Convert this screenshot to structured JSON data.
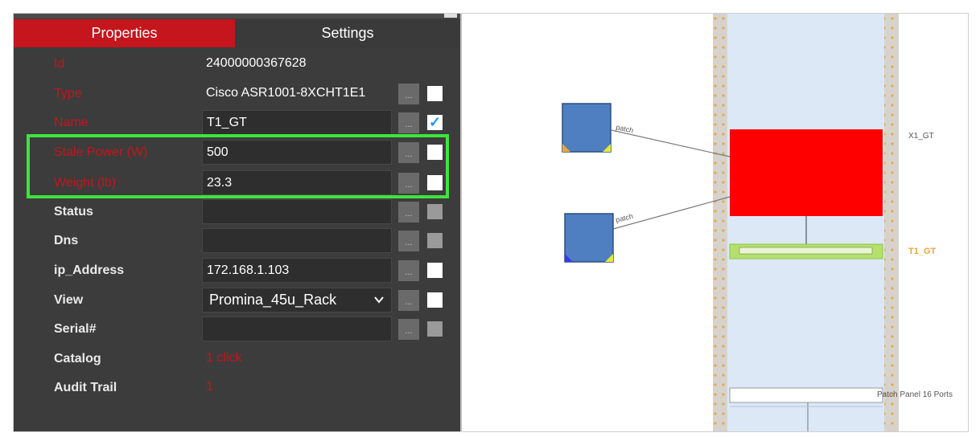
{
  "tabs": {
    "properties": "Properties",
    "settings": "Settings"
  },
  "rows": [
    {
      "key": "id",
      "label": "Id",
      "value": "24000000367628"
    },
    {
      "key": "type",
      "label": "Type",
      "value": "Cisco ASR1001-8XCHT1E1"
    },
    {
      "key": "name",
      "label": "Name",
      "value": "T1_GT",
      "checked": true
    },
    {
      "key": "stale_power",
      "label": "Stale Power (W)",
      "value": "500"
    },
    {
      "key": "weight",
      "label": "Weight (lb)",
      "value": "23.3"
    },
    {
      "key": "status",
      "label": "Status",
      "value": ""
    },
    {
      "key": "dns",
      "label": "Dns",
      "value": ""
    },
    {
      "key": "ip_address",
      "label": "ip_Address",
      "value": "172.168.1.103"
    },
    {
      "key": "view",
      "label": "View",
      "value": "Promina_45u_Rack"
    },
    {
      "key": "serial",
      "label": "Serial#",
      "value": ""
    },
    {
      "key": "catalog",
      "label": "Catalog",
      "value": "1 click"
    },
    {
      "key": "audit_trail",
      "label": "Audit Trail",
      "value": "1"
    }
  ],
  "button_ellipsis": "...",
  "icons": {
    "checkmark": "✓",
    "dropdown": "chevron-down-icon"
  },
  "diagram": {
    "patch_label_1": "patch",
    "patch_label_2": "patch",
    "device_x1": "X1_GT",
    "device_t1": "T1_GT",
    "patch_panel": "Patch Panel 16 Ports"
  },
  "colors": {
    "accent_red": "#c4161c",
    "highlight_green": "#3de43d",
    "device_red": "#ff0000",
    "device_green": "#b5e06e",
    "rack_blue": "#dce8f6",
    "node_blue": "#4f7fc0"
  }
}
